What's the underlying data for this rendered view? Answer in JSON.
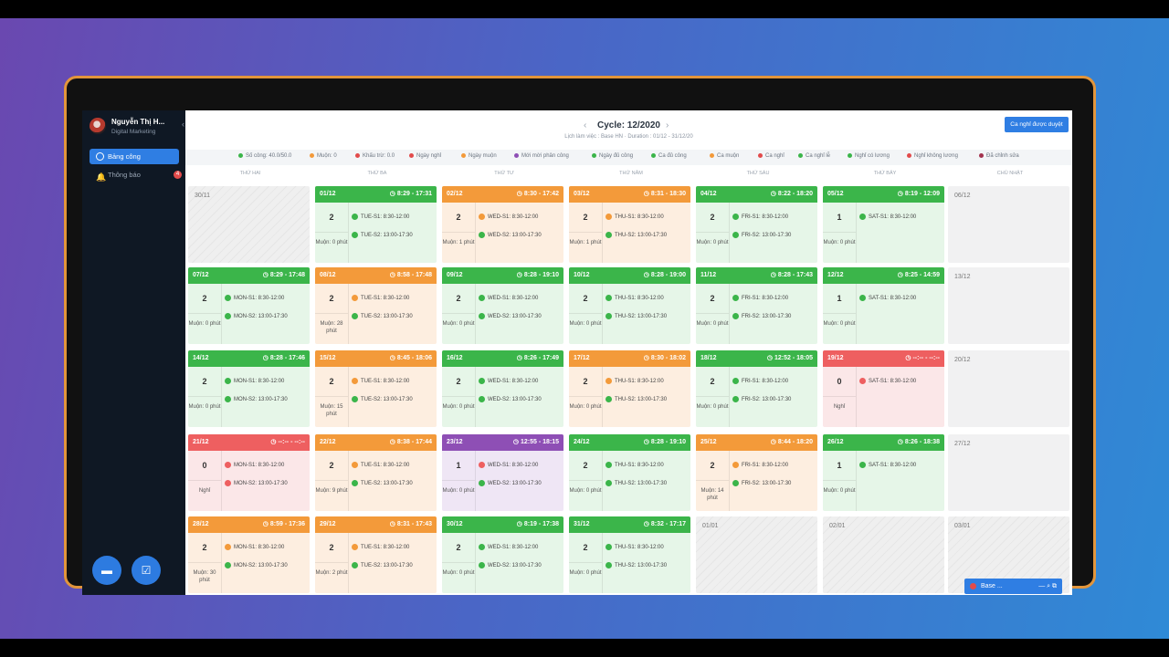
{
  "user": {
    "name": "Nguyễn Thị H...",
    "role": "Digital Marketing"
  },
  "nav": [
    {
      "label": "Bảng công",
      "active": true
    },
    {
      "label": "Thông báo",
      "badge": "4"
    }
  ],
  "header": {
    "title": "Cycle: 12/2020",
    "subtitle": "Lịch làm việc : Base HN · Duration : 01/12 - 31/12/20",
    "approve_button": "Ca nghỉ được duyệt"
  },
  "legend": [
    {
      "label": "Số công: 40.0/50.0",
      "color": "#3bb54a"
    },
    {
      "label": "Muộn: 0",
      "color": "#f39a3a"
    },
    {
      "label": "Khấu trừ: 0.0",
      "color": "#e24b4b"
    },
    {
      "label": "Ngày nghỉ",
      "color": "#e24b4b"
    },
    {
      "label": "Ngày muộn",
      "color": "#f39a3a"
    },
    {
      "label": "Mới mời phân công",
      "color": "#8e4fb5"
    },
    {
      "label": "Ngày đủ công",
      "color": "#3bb54a"
    },
    {
      "label": "Ca đủ công",
      "color": "#3bb54a"
    },
    {
      "label": "Ca muộn",
      "color": "#f39a3a"
    },
    {
      "label": "Ca nghỉ",
      "color": "#e24b4b"
    },
    {
      "label": "Ca nghỉ lễ",
      "color": "#3bb54a"
    },
    {
      "label": "Nghỉ có lương",
      "color": "#3bb54a"
    },
    {
      "label": "Nghỉ không lương",
      "color": "#e24b4b"
    },
    {
      "label": "Đã chỉnh sửa",
      "color": "#a3334e"
    }
  ],
  "days": [
    "THỨ HAI",
    "THỨ BA",
    "THỨ TƯ",
    "THỨ NĂM",
    "THỨ SÁU",
    "THỨ BẢY",
    "CHỦ NHẬT"
  ],
  "colors": {
    "green": "#3bb54a",
    "orange": "#f39a3a",
    "red": "#ee5f60",
    "purple": "#8e4fb5",
    "green_bg": "#e6f6e8",
    "orange_bg": "#fdeee0",
    "red_bg": "#fbe7e8",
    "purple_bg": "#efe6f5"
  },
  "weeks": [
    [
      {
        "d": "30/11",
        "t": "hat"
      },
      {
        "d": "01/12",
        "t": "green",
        "time": "8:29 - 17:31",
        "n": "2",
        "late": "Muộn: 0 phút",
        "s": [
          [
            "TUE-S1: 8:30-12:00",
            "green"
          ],
          [
            "TUE-S2: 13:00-17:30",
            "green"
          ]
        ]
      },
      {
        "d": "02/12",
        "t": "orange",
        "time": "8:30 - 17:42",
        "n": "2",
        "late": "Muộn: 1 phút",
        "s": [
          [
            "WED-S1: 8:30-12:00",
            "orange"
          ],
          [
            "WED-S2: 13:00-17:30",
            "green"
          ]
        ]
      },
      {
        "d": "03/12",
        "t": "orange",
        "time": "8:31 - 18:30",
        "n": "2",
        "late": "Muộn: 1 phút",
        "s": [
          [
            "THU-S1: 8:30-12:00",
            "orange"
          ],
          [
            "THU-S2: 13:00-17:30",
            "green"
          ]
        ]
      },
      {
        "d": "04/12",
        "t": "green",
        "time": "8:22 - 18:20",
        "n": "2",
        "late": "Muộn: 0 phút",
        "s": [
          [
            "FRI-S1: 8:30-12:00",
            "green"
          ],
          [
            "FRI-S2: 13:00-17:30",
            "green"
          ]
        ]
      },
      {
        "d": "05/12",
        "t": "green",
        "time": "8:19 - 12:09",
        "n": "1",
        "late": "Muộn: 0 phút",
        "s": [
          [
            "SAT-S1: 8:30-12:00",
            "green"
          ]
        ]
      },
      {
        "d": "06/12",
        "t": "emp"
      }
    ],
    [
      {
        "d": "07/12",
        "t": "green",
        "time": "8:29 - 17:48",
        "n": "2",
        "late": "Muộn: 0 phút",
        "s": [
          [
            "MON-S1: 8:30-12:00",
            "green"
          ],
          [
            "MON-S2: 13:00-17:30",
            "green"
          ]
        ]
      },
      {
        "d": "08/12",
        "t": "orange",
        "time": "8:58 - 17:48",
        "n": "2",
        "late": "Muộn: 28 phút",
        "s": [
          [
            "TUE-S1: 8:30-12:00",
            "orange"
          ],
          [
            "TUE-S2: 13:00-17:30",
            "green"
          ]
        ]
      },
      {
        "d": "09/12",
        "t": "green",
        "time": "8:28 - 19:10",
        "n": "2",
        "late": "Muộn: 0 phút",
        "s": [
          [
            "WED-S1: 8:30-12:00",
            "green"
          ],
          [
            "WED-S2: 13:00-17:30",
            "green"
          ]
        ]
      },
      {
        "d": "10/12",
        "t": "green",
        "time": "8:28 - 19:00",
        "n": "2",
        "late": "Muộn: 0 phút",
        "s": [
          [
            "THU-S1: 8:30-12:00",
            "green"
          ],
          [
            "THU-S2: 13:00-17:30",
            "green"
          ]
        ]
      },
      {
        "d": "11/12",
        "t": "green",
        "time": "8:28 - 17:43",
        "n": "2",
        "late": "Muộn: 0 phút",
        "s": [
          [
            "FRI-S1: 8:30-12:00",
            "green"
          ],
          [
            "FRI-S2: 13:00-17:30",
            "green"
          ]
        ]
      },
      {
        "d": "12/12",
        "t": "green",
        "time": "8:25 - 14:59",
        "n": "1",
        "late": "Muộn: 0 phút",
        "s": [
          [
            "SAT-S1: 8:30-12:00",
            "green"
          ]
        ]
      },
      {
        "d": "13/12",
        "t": "emp"
      }
    ],
    [
      {
        "d": "14/12",
        "t": "green",
        "time": "8:28 - 17:46",
        "n": "2",
        "late": "Muộn: 0 phút",
        "s": [
          [
            "MON-S1: 8:30-12:00",
            "green"
          ],
          [
            "MON-S2: 13:00-17:30",
            "green"
          ]
        ]
      },
      {
        "d": "15/12",
        "t": "orange",
        "time": "8:45 - 18:06",
        "n": "2",
        "late": "Muộn: 15 phút",
        "s": [
          [
            "TUE-S1: 8:30-12:00",
            "orange"
          ],
          [
            "TUE-S2: 13:00-17:30",
            "green"
          ]
        ]
      },
      {
        "d": "16/12",
        "t": "green",
        "time": "8:26 - 17:49",
        "n": "2",
        "late": "Muộn: 0 phút",
        "s": [
          [
            "WED-S1: 8:30-12:00",
            "green"
          ],
          [
            "WED-S2: 13:00-17:30",
            "green"
          ]
        ]
      },
      {
        "d": "17/12",
        "t": "orange",
        "time": "8:30 - 18:02",
        "n": "2",
        "late": "Muộn: 0 phút",
        "s": [
          [
            "THU-S1: 8:30-12:00",
            "orange"
          ],
          [
            "THU-S2: 13:00-17:30",
            "green"
          ]
        ]
      },
      {
        "d": "18/12",
        "t": "green",
        "time": "12:52 - 18:05",
        "n": "2",
        "late": "Muộn: 0 phút",
        "s": [
          [
            "FRI-S1: 8:30-12:00",
            "green"
          ],
          [
            "FRI-S2: 13:00-17:30",
            "green"
          ]
        ]
      },
      {
        "d": "19/12",
        "t": "red",
        "time": "--:-- - --:--",
        "n": "0",
        "late": "Nghỉ",
        "s": [
          [
            "SAT-S1: 8:30-12:00",
            "red"
          ]
        ]
      },
      {
        "d": "20/12",
        "t": "emp"
      }
    ],
    [
      {
        "d": "21/12",
        "t": "red",
        "time": "--:-- - --:--",
        "n": "0",
        "late": "Nghỉ",
        "s": [
          [
            "MON-S1: 8:30-12:00",
            "red"
          ],
          [
            "MON-S2: 13:00-17:30",
            "red"
          ]
        ]
      },
      {
        "d": "22/12",
        "t": "orange",
        "time": "8:38 - 17:44",
        "n": "2",
        "late": "Muộn: 9 phút",
        "s": [
          [
            "TUE-S1: 8:30-12:00",
            "orange"
          ],
          [
            "TUE-S2: 13:00-17:30",
            "green"
          ]
        ]
      },
      {
        "d": "23/12",
        "t": "purple",
        "time": "12:55 - 18:15",
        "n": "1",
        "late": "Muộn: 0 phút",
        "s": [
          [
            "WED-S1: 8:30-12:00",
            "red"
          ],
          [
            "WED-S2: 13:00-17:30",
            "green"
          ]
        ]
      },
      {
        "d": "24/12",
        "t": "green",
        "time": "8:28 - 19:10",
        "n": "2",
        "late": "Muộn: 0 phút",
        "s": [
          [
            "THU-S1: 8:30-12:00",
            "green"
          ],
          [
            "THU-S2: 13:00-17:30",
            "green"
          ]
        ]
      },
      {
        "d": "25/12",
        "t": "orange",
        "time": "8:44 - 18:20",
        "n": "2",
        "late": "Muộn: 14 phút",
        "s": [
          [
            "FRI-S1: 8:30-12:00",
            "orange"
          ],
          [
            "FRI-S2: 13:00-17:30",
            "green"
          ]
        ]
      },
      {
        "d": "26/12",
        "t": "green",
        "time": "8:26 - 18:38",
        "n": "1",
        "late": "Muộn: 0 phút",
        "s": [
          [
            "SAT-S1: 8:30-12:00",
            "green"
          ]
        ]
      },
      {
        "d": "27/12",
        "t": "emp"
      }
    ],
    [
      {
        "d": "28/12",
        "t": "orange",
        "time": "8:59 - 17:36",
        "n": "2",
        "late": "Muộn: 30 phút",
        "s": [
          [
            "MON-S1: 8:30-12:00",
            "orange"
          ],
          [
            "MON-S2: 13:00-17:30",
            "green"
          ]
        ]
      },
      {
        "d": "29/12",
        "t": "orange",
        "time": "8:31 - 17:43",
        "n": "2",
        "late": "Muộn: 2 phút",
        "s": [
          [
            "TUE-S1: 8:30-12:00",
            "orange"
          ],
          [
            "TUE-S2: 13:00-17:30",
            "green"
          ]
        ]
      },
      {
        "d": "30/12",
        "t": "green",
        "time": "8:19 - 17:38",
        "n": "2",
        "late": "Muộn: 0 phút",
        "s": [
          [
            "WED-S1: 8:30-12:00",
            "green"
          ],
          [
            "WED-S2: 13:00-17:30",
            "green"
          ]
        ]
      },
      {
        "d": "31/12",
        "t": "green",
        "time": "8:32 - 17:17",
        "n": "2",
        "late": "Muộn: 0 phút",
        "s": [
          [
            "THU-S1: 8:30-12:00",
            "green"
          ],
          [
            "THU-S2: 13:00-17:30",
            "green"
          ]
        ]
      },
      {
        "d": "01/01",
        "t": "hat"
      },
      {
        "d": "02/01",
        "t": "hat"
      },
      {
        "d": "03/01",
        "t": "hat"
      }
    ]
  ],
  "mini_widget": {
    "label": "Base ..."
  }
}
